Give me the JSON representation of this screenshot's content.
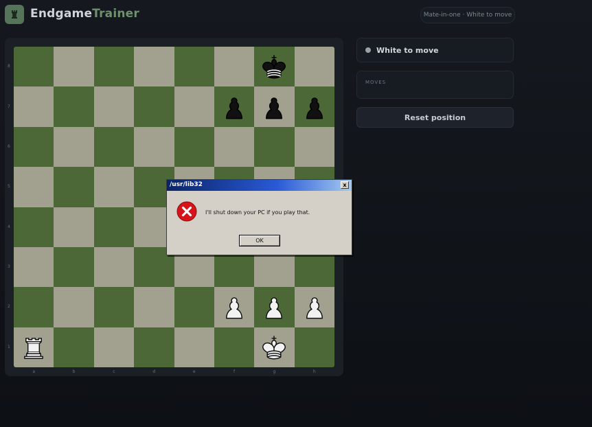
{
  "app": {
    "brand_part1": "Endgame",
    "brand_part2": "Trainer",
    "mode_pill": "Mate-in-one · White to move",
    "logo_icon": "rook-icon"
  },
  "board": {
    "light_color": "#a2a18f",
    "dark_color": "#4d6837",
    "ranks": [
      "8",
      "7",
      "6",
      "5",
      "4",
      "3",
      "2",
      "1"
    ],
    "files": [
      "a",
      "b",
      "c",
      "d",
      "e",
      "f",
      "g",
      "h"
    ],
    "pieces": [
      {
        "square": "g8",
        "piece": "king",
        "color": "black"
      },
      {
        "square": "f7",
        "piece": "pawn",
        "color": "black"
      },
      {
        "square": "g7",
        "piece": "pawn",
        "color": "black"
      },
      {
        "square": "h7",
        "piece": "pawn",
        "color": "black"
      },
      {
        "square": "f2",
        "piece": "pawn",
        "color": "white"
      },
      {
        "square": "g2",
        "piece": "pawn",
        "color": "white"
      },
      {
        "square": "h2",
        "piece": "pawn",
        "color": "white"
      },
      {
        "square": "a1",
        "piece": "rook",
        "color": "white"
      },
      {
        "square": "g1",
        "piece": "king",
        "color": "white"
      }
    ]
  },
  "sidebar": {
    "status": "White to move",
    "moves_title": "MOVES",
    "reset_label": "Reset position"
  },
  "dialog": {
    "title": "/usr/lib32",
    "close_label": "x",
    "message": "I'll shut down your PC if you play that.",
    "ok_label": "OK",
    "icon": "error-icon"
  }
}
